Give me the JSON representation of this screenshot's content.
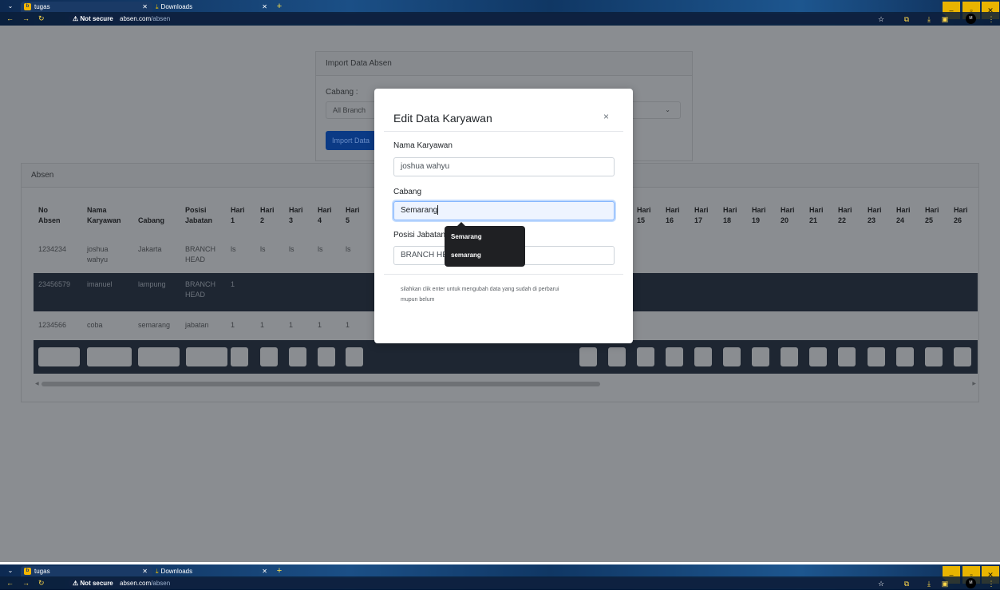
{
  "browser": {
    "tabs": [
      {
        "title": "tugas",
        "favicon": "b"
      },
      {
        "title": "Downloads",
        "icon": "download-icon"
      }
    ],
    "url_warning": "Not secure",
    "url_host": "absen.com",
    "url_path": "/absen",
    "avatar_text": "M"
  },
  "import_card": {
    "title": "Import Data Absen",
    "cabang_label": "Cabang :",
    "cabang_value": "All Branch",
    "import_button": "Import Data"
  },
  "absen_card": {
    "title": "Absen",
    "headers": {
      "no_absen": [
        "No",
        "Absen"
      ],
      "nama": [
        "Nama",
        "Karyawan"
      ],
      "cabang": "Cabang",
      "posisi": [
        "Posisi",
        "Jabatan"
      ],
      "hari_left": [
        [
          "Hari",
          "1"
        ],
        [
          "Hari",
          "2"
        ],
        [
          "Hari",
          "3"
        ],
        [
          "Hari",
          "4"
        ],
        [
          "Hari",
          "5"
        ]
      ],
      "hari_right": [
        [
          "Hari",
          "15"
        ],
        [
          "Hari",
          "16"
        ],
        [
          "Hari",
          "17"
        ],
        [
          "Hari",
          "18"
        ],
        [
          "Hari",
          "19"
        ],
        [
          "Hari",
          "20"
        ],
        [
          "Hari",
          "21"
        ],
        [
          "Hari",
          "22"
        ],
        [
          "Hari",
          "23"
        ],
        [
          "Hari",
          "24"
        ],
        [
          "Hari",
          "25"
        ],
        [
          "Hari",
          "26"
        ]
      ]
    },
    "rows": [
      {
        "no": "1234234",
        "nama": [
          "joshua",
          "wahyu"
        ],
        "cabang": "Jakarta",
        "posisi": [
          "BRANCH",
          "HEAD"
        ],
        "hari": [
          "ls",
          "ls",
          "ls",
          "ls",
          "ls"
        ]
      },
      {
        "no": "23456579",
        "nama": [
          "imanuel",
          ""
        ],
        "cabang": "lampung",
        "posisi": [
          "BRANCH",
          "HEAD"
        ],
        "hari": [
          "1",
          "",
          "",
          "",
          ""
        ]
      },
      {
        "no": "1234566",
        "nama": [
          "coba",
          ""
        ],
        "cabang": "semarang",
        "posisi": [
          "jabatan",
          ""
        ],
        "hari": [
          "1",
          "1",
          "1",
          "1",
          "1"
        ]
      }
    ]
  },
  "modal": {
    "title": "Edit Data Karyawan",
    "close": "×",
    "nama_label": "Nama Karyawan",
    "nama_value": "joshua wahyu",
    "cabang_label": "Cabang",
    "cabang_value": "Semarang",
    "posisi_label": "Posisi Jabatan",
    "posisi_value": "BRANCH HE",
    "note_line1": "silahkan clik enter untuk mengubah data yang sudah di perbarui",
    "note_line2": "mupun belum"
  },
  "autocomplete": {
    "options": [
      "Semarang",
      "semarang"
    ]
  }
}
